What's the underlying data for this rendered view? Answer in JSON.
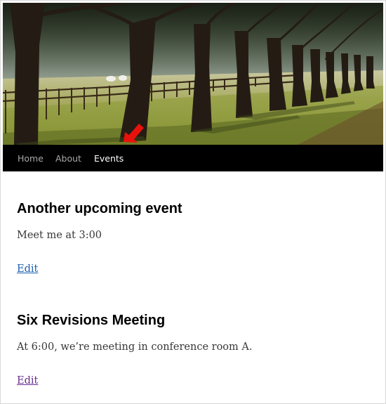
{
  "header_image": {
    "description_icon": "tree-avenue-header-image",
    "annotation_icon": "red-arrow-icon"
  },
  "nav": {
    "items": [
      {
        "label": "Home",
        "current": false
      },
      {
        "label": "About",
        "current": false
      },
      {
        "label": "Events",
        "current": true
      }
    ]
  },
  "posts": [
    {
      "title": "Another upcoming event",
      "body": "Meet me at 3:00",
      "edit_label": "Edit",
      "edit_color": "#1a5eb3"
    },
    {
      "title": "Six Revisions Meeting",
      "body": "At 6:00, we’re meeting in conference room A.",
      "edit_label": "Edit",
      "edit_color": "#6b2c91"
    }
  ],
  "colors": {
    "nav_background": "#000000",
    "nav_text": "#a8a8a8",
    "nav_text_current": "#ffffff",
    "arrow": "#e8120c"
  }
}
